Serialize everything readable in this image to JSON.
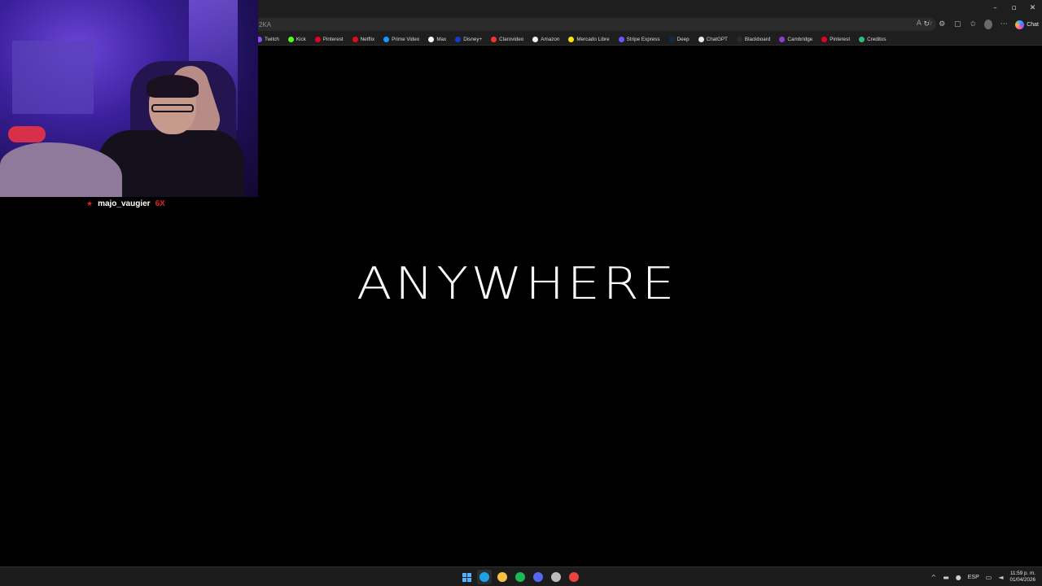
{
  "browser": {
    "address_text": "2KA",
    "window_controls": {
      "minimize": "–",
      "maximize": "▫",
      "close": "✕"
    },
    "copilot_label": "Chat",
    "bookmarks": [
      {
        "label": "Twitch",
        "icon": "twitch-icon",
        "color": "#9146ff"
      },
      {
        "label": "Kick",
        "icon": "kick-icon",
        "color": "#53fc18"
      },
      {
        "label": "Pinterest",
        "icon": "pinterest-icon",
        "color": "#e60023"
      },
      {
        "label": "Netflix",
        "icon": "netflix-icon",
        "color": "#e50914"
      },
      {
        "label": "Prime Video",
        "icon": "prime-video-icon",
        "color": "#1a98ff"
      },
      {
        "label": "Max",
        "icon": "max-icon",
        "color": "#ffffff"
      },
      {
        "label": "Disney+",
        "icon": "disney-plus-icon",
        "color": "#113ccf"
      },
      {
        "label": "Clarovideo",
        "icon": "clarovideo-icon",
        "color": "#ef3829"
      },
      {
        "label": "Amazon",
        "icon": "amazon-icon",
        "color": "#f0f0f0"
      },
      {
        "label": "Mercado Libre",
        "icon": "mercado-libre-icon",
        "color": "#ffe600"
      },
      {
        "label": "Stripe Express",
        "icon": "stripe-icon",
        "color": "#635bff"
      },
      {
        "label": "Deep",
        "icon": "deepl-icon",
        "color": "#0f2b46"
      },
      {
        "label": "ChatGPT",
        "icon": "chatgpt-icon",
        "color": "#e8e8e8"
      },
      {
        "label": "Blackboard",
        "icon": "blackboard-icon",
        "color": "#2a2a2a"
      },
      {
        "label": "Cambridge",
        "icon": "cambridge-icon",
        "color": "#8b3fd9"
      },
      {
        "label": "Pinterest",
        "icon": "pinterest-icon",
        "color": "#e60023"
      },
      {
        "label": "Creditos",
        "icon": "creditos-icon",
        "color": "#2dbf7a"
      }
    ]
  },
  "content": {
    "headline": "ANYWHERE"
  },
  "stream_overlay": {
    "username": "majo_vaugier",
    "suffix": "6X",
    "star": "★"
  },
  "taskbar": {
    "apps": [
      {
        "name": "start-menu-icon"
      },
      {
        "name": "edge-icon",
        "color": "#1fa0e6",
        "active": true
      },
      {
        "name": "file-explorer-icon",
        "color": "#f6c144"
      },
      {
        "name": "spotify-icon",
        "color": "#1db954"
      },
      {
        "name": "discord-icon",
        "color": "#5865f2"
      },
      {
        "name": "obs-icon",
        "color": "#bbbbbb"
      },
      {
        "name": "chrome-icon",
        "color": "#e8453c"
      }
    ],
    "language": "ESP",
    "time": "11:59 p. m.",
    "date": "01/04/2026"
  }
}
